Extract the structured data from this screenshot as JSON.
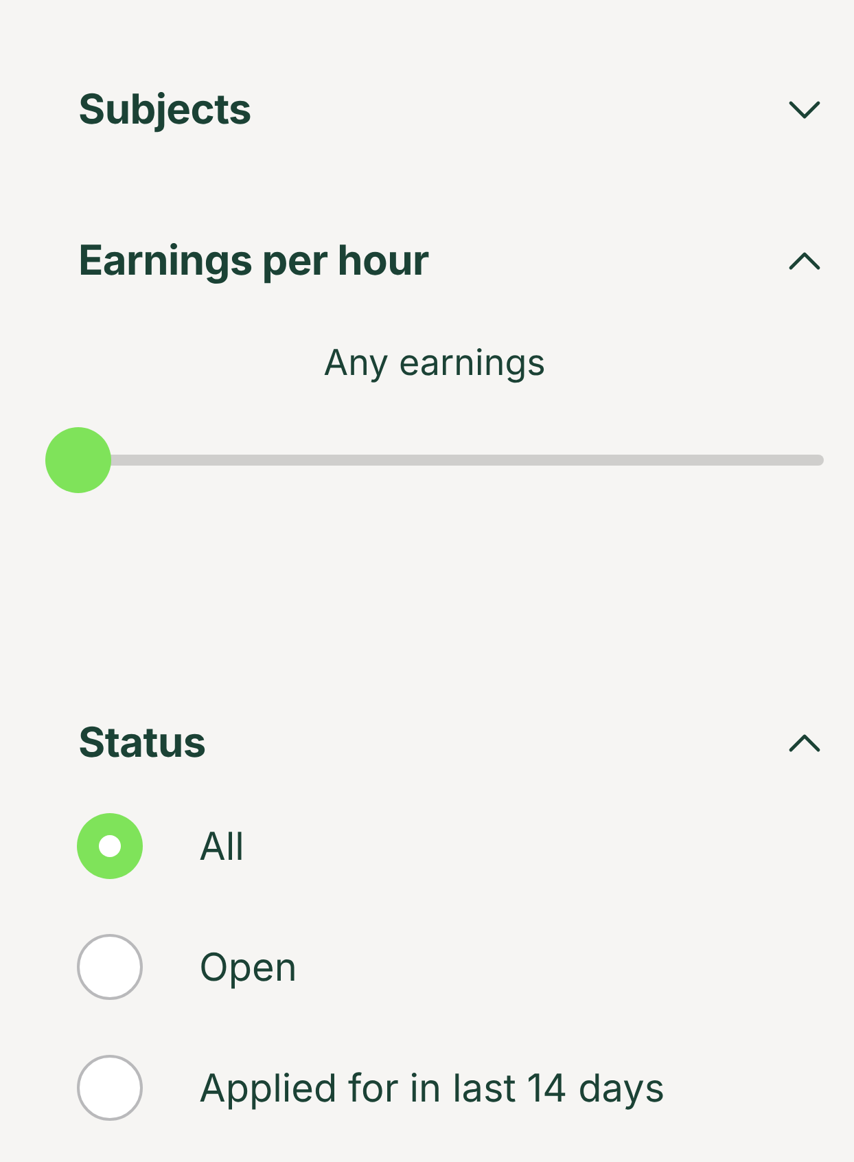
{
  "sections": [
    {
      "title": "Subjects",
      "expanded": false
    },
    {
      "kind": "slider",
      "title": "Earnings per hour",
      "expanded": true,
      "reading": "Any earnings",
      "level": 0
    },
    {
      "kind": "radios",
      "title": "Status",
      "expanded": true,
      "options": [
        {
          "label": "All",
          "selected": true
        },
        {
          "label": "Open",
          "selected": false
        },
        {
          "label": "Applied for in last 14 days",
          "selected": false
        }
      ]
    }
  ]
}
